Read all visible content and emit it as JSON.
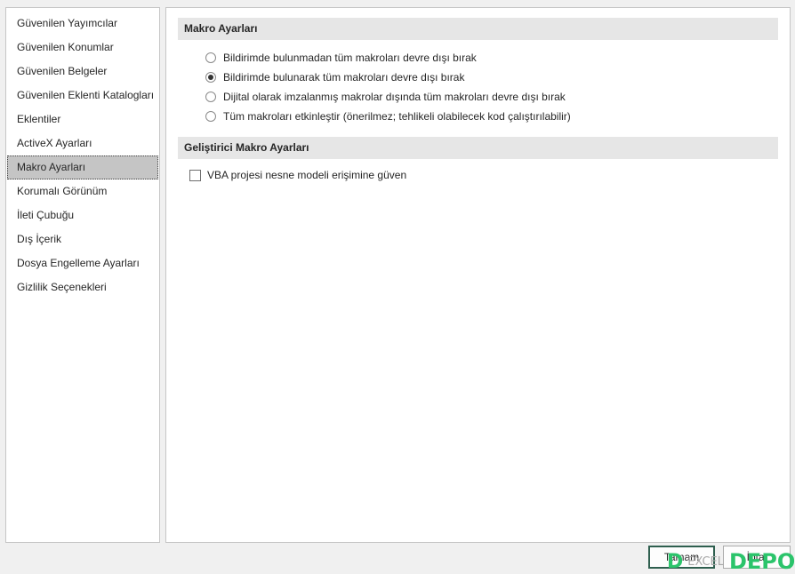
{
  "nav": {
    "items": [
      {
        "label": "Güvenilen Yayımcılar"
      },
      {
        "label": "Güvenilen Konumlar"
      },
      {
        "label": "Güvenilen Belgeler"
      },
      {
        "label": "Güvenilen Eklenti Katalogları"
      },
      {
        "label": "Eklentiler"
      },
      {
        "label": "ActiveX Ayarları"
      },
      {
        "label": "Makro Ayarları",
        "selected": true
      },
      {
        "label": "Korumalı Görünüm"
      },
      {
        "label": "İleti Çubuğu"
      },
      {
        "label": "Dış İçerik"
      },
      {
        "label": "Dosya Engelleme Ayarları"
      },
      {
        "label": "Gizlilik Seçenekleri"
      }
    ]
  },
  "macro_settings": {
    "title": "Makro Ayarları",
    "options": [
      {
        "label": "Bildirimde bulunmadan tüm makroları devre dışı bırak",
        "checked": false
      },
      {
        "label": "Bildirimde bulunarak tüm makroları devre dışı bırak",
        "checked": true
      },
      {
        "label": "Dijital olarak imzalanmış makrolar dışında tüm makroları devre dışı bırak",
        "checked": false
      },
      {
        "label": "Tüm makroları etkinleştir (önerilmez; tehlikeli olabilecek kod çalıştırılabilir)",
        "checked": false
      }
    ]
  },
  "developer_settings": {
    "title": "Geliştirici Makro Ayarları",
    "vba_label": "VBA projesi nesne modeli erişimine güven",
    "vba_checked": false
  },
  "buttons": {
    "ok": "Tamam",
    "cancel": "İptal"
  },
  "watermark": {
    "text": "EXCEL",
    "brand": "DEPO"
  },
  "colors": {
    "selected_bg": "#c5c5c5",
    "section_bg": "#e6e6e6",
    "watermark_green": "#2bc46b"
  }
}
